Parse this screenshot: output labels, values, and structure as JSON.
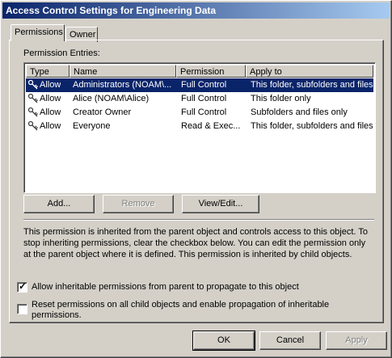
{
  "window": {
    "title": "Access Control Settings for Engineering Data"
  },
  "tabs": [
    {
      "label": "Permissions",
      "active": true
    },
    {
      "label": "Owner",
      "active": false
    }
  ],
  "permission_entries_label": "Permission Entries:",
  "columns": [
    "Type",
    "Name",
    "Permission",
    "Apply to"
  ],
  "entries": [
    {
      "type": "Allow",
      "name": "Administrators (NOAM\\...",
      "permission": "Full Control",
      "apply_to": "This folder, subfolders and files",
      "selected": true
    },
    {
      "type": "Allow",
      "name": "Alice (NOAM\\Alice)",
      "permission": "Full Control",
      "apply_to": "This folder only",
      "selected": false
    },
    {
      "type": "Allow",
      "name": "Creator Owner",
      "permission": "Full Control",
      "apply_to": "Subfolders and files only",
      "selected": false
    },
    {
      "type": "Allow",
      "name": "Everyone",
      "permission": "Read & Exec...",
      "apply_to": "This folder, subfolders and files",
      "selected": false
    }
  ],
  "buttons": {
    "add": "Add...",
    "remove": "Remove",
    "view_edit": "View/Edit..."
  },
  "info_text": "This permission is inherited from the parent object and controls access to this object.  To stop inheriting permissions, clear the checkbox below.  You can edit the permission only at the parent object where it is defined. This permission is inherited by child objects.",
  "checkboxes": {
    "inherit": {
      "label": "Allow inheritable permissions from parent to propagate to this object",
      "checked": true
    },
    "reset": {
      "label": "Reset permissions on all child objects and enable propagation of inheritable permissions.",
      "checked": false
    }
  },
  "footer": {
    "ok": "OK",
    "cancel": "Cancel",
    "apply": "Apply"
  },
  "colors": {
    "title_start": "#0a246a",
    "title_end": "#a6caf0",
    "selection": "#0a246a",
    "face": "#d4d0c8"
  },
  "icons": {
    "entry": "key-person-icon"
  }
}
